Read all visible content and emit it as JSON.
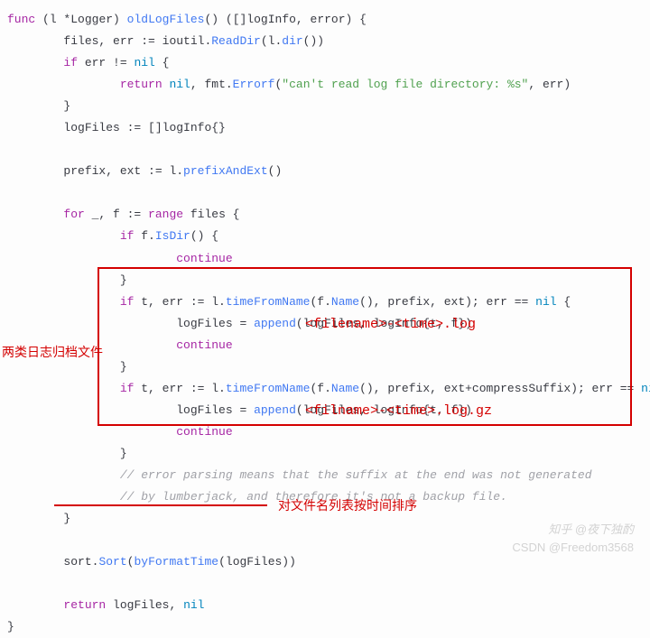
{
  "code": {
    "l1_func": "func",
    "l1_recv": "(l *Logger)",
    "l1_name": "oldLogFiles",
    "l1_sig": "() ([]logInfo, error) {",
    "l2a": "files, err := ioutil.",
    "l2_fn": "ReadDir",
    "l2b": "(l.",
    "l2_fn2": "dir",
    "l2c": "())",
    "l3_if": "if",
    "l3_cond": " err != ",
    "l3_nil": "nil",
    "l3_brace": " {",
    "l4_ret": "return",
    "l4_nil": " nil",
    "l4_a": ", fmt.",
    "l4_fn": "Errorf",
    "l4_b": "(",
    "l4_str": "\"can't read log file directory: %s\"",
    "l4_c": ", err)",
    "l5_brace": "}",
    "l6": "logFiles := []logInfo{}",
    "l7a": "prefix, ext := l.",
    "l7_fn": "prefixAndExt",
    "l7b": "()",
    "l8_for": "for",
    "l8_a": " _, f := ",
    "l8_range": "range",
    "l8_b": " files {",
    "l9_if": "if",
    "l9_a": " f.",
    "l9_fn": "IsDir",
    "l9_b": "() {",
    "l10_cont": "continue",
    "l11_brace": "}",
    "l12_if": "if",
    "l12_a": " t, err := l.",
    "l12_fn": "timeFromName",
    "l12_b": "(f.",
    "l12_fn2": "Name",
    "l12_c": "(), prefix, ext); err == ",
    "l12_nil": "nil",
    "l12_brace": " {",
    "l13_a": "logFiles = ",
    "l13_fn": "append",
    "l13_b": "(logFiles, logInfo{t, f})",
    "l14_cont": "continue",
    "l15_brace": "}",
    "l16_if": "if",
    "l16_a": " t, err := l.",
    "l16_fn": "timeFromName",
    "l16_b": "(f.",
    "l16_fn2": "Name",
    "l16_c": "(), prefix, ext+compressSuffix); err == ",
    "l16_nil": "nil",
    "l16_brace": " {",
    "l17_a": "logFiles = ",
    "l17_fn": "append",
    "l17_b": "(logFiles, logInfo{t, f})",
    "l18_cont": "continue",
    "l19_brace": "}",
    "l20_cmt": "// error parsing means that the suffix at the end was not generated",
    "l21_cmt": "// by lumberjack, and therefore it's not a backup file.",
    "l22_brace": "}",
    "l23_a": "sort.",
    "l23_fn": "Sort",
    "l23_b": "(",
    "l23_fn2": "byFormatTime",
    "l23_c": "(logFiles))",
    "l24_ret": "return",
    "l24_a": " logFiles, ",
    "l24_nil": "nil",
    "l25_brace": "}"
  },
  "annotations": {
    "left_label": "两类日志归档文件",
    "format1": "<filename>-<time>.log",
    "format2": "<filname>-<time>.log.gz",
    "sort_label": "对文件名列表按时间排序"
  },
  "watermarks": {
    "zhihu": "知乎 @夜下独酌",
    "csdn": "CSDN @Freedom3568"
  }
}
